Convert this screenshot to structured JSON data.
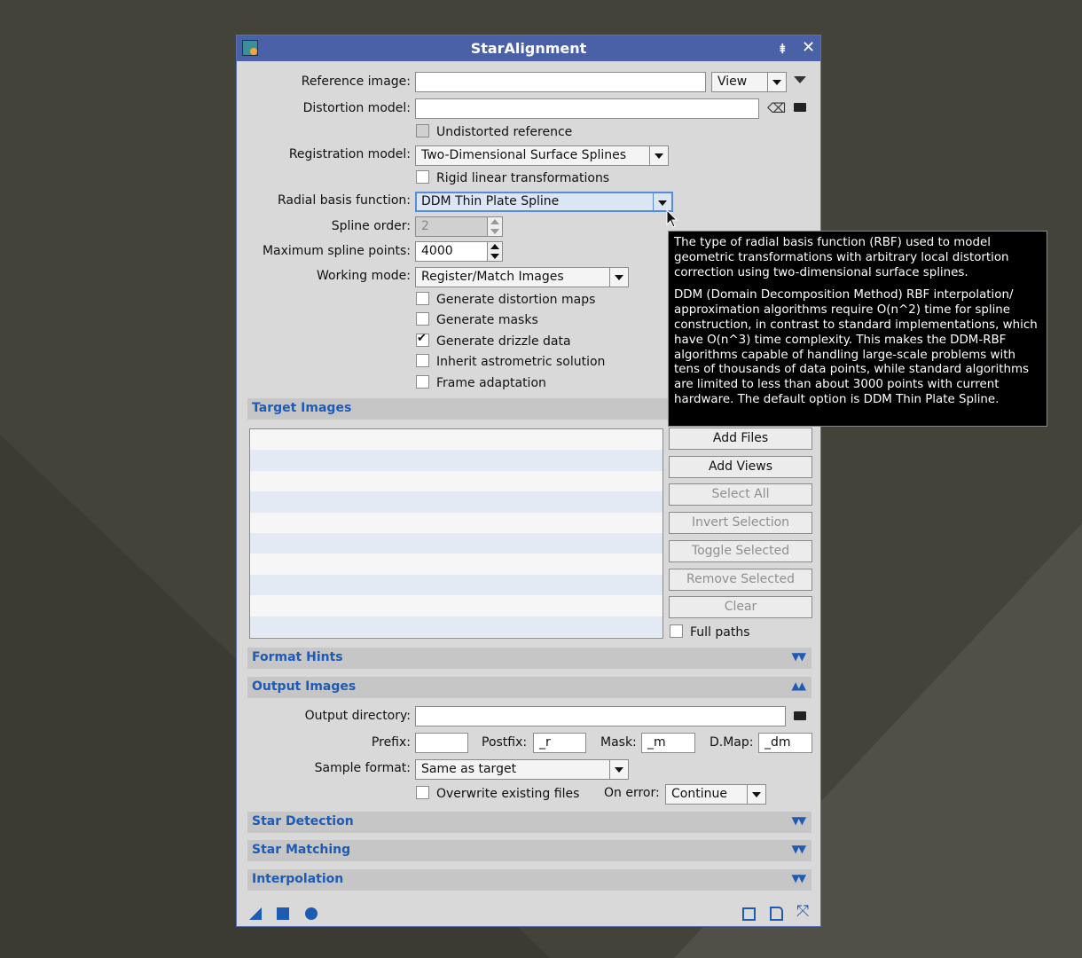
{
  "window": {
    "title": "StarAlignment",
    "shade_icon": "shade-icon",
    "close_icon": "close-icon"
  },
  "form": {
    "reference_image_label": "Reference image:",
    "reference_image_value": "",
    "reference_view_option": "View",
    "distortion_model_label": "Distortion model:",
    "distortion_model_value": "",
    "undistorted_reference": "Undistorted reference",
    "registration_model_label": "Registration model:",
    "registration_model_value": "Two-Dimensional Surface Splines",
    "rigid_linear": "Rigid linear transformations",
    "radial_basis_label": "Radial basis function:",
    "radial_basis_value": "DDM Thin Plate Spline",
    "spline_order_label": "Spline order:",
    "spline_order_value": "2",
    "max_spline_points_label": "Maximum spline points:",
    "max_spline_points_value": "4000",
    "working_mode_label": "Working mode:",
    "working_mode_value": "Register/Match Images",
    "checks": [
      {
        "label": "Generate distortion maps",
        "checked": false
      },
      {
        "label": "Generate masks",
        "checked": false
      },
      {
        "label": "Generate drizzle data",
        "checked": true
      },
      {
        "label": "Inherit astrometric solution",
        "checked": false
      },
      {
        "label": "Frame adaptation",
        "checked": false
      }
    ]
  },
  "target_images": {
    "section_title": "Target Images",
    "buttons": [
      "Add Files",
      "Add Views",
      "Select All",
      "Invert Selection",
      "Toggle Selected",
      "Remove Selected",
      "Clear"
    ],
    "full_paths": "Full paths"
  },
  "format_hints": {
    "section_title": "Format Hints"
  },
  "output_images": {
    "section_title": "Output Images",
    "output_directory_label": "Output directory:",
    "output_directory_value": "",
    "prefix_label": "Prefix:",
    "prefix_value": "",
    "postfix_label": "Postfix:",
    "postfix_value": "_r",
    "mask_label": "Mask:",
    "mask_value": "_m",
    "dmap_label": "D.Map:",
    "dmap_value": "_dm",
    "sample_format_label": "Sample format:",
    "sample_format_value": "Same as target",
    "overwrite": "Overwrite existing files",
    "on_error_label": "On error:",
    "on_error_value": "Continue"
  },
  "sections": {
    "star_detection": "Star Detection",
    "star_matching": "Star Matching",
    "interpolation": "Interpolation"
  },
  "tooltip": {
    "p1": "The type of radial basis function (RBF) used to model geometric transformations with arbitrary local distortion correction using two-dimensional surface splines.",
    "p2": "DDM (Domain Decomposition Method) RBF interpolation/ approximation algorithms require O(n^2) time for spline construction, in contrast to standard implementations, which have O(n^3) time complexity. This makes the DDM-RBF algorithms capable of handling large-scale problems with tens of thousands of data points, while standard algorithms are limited to less than about 3000 points with current hardware. The default option is DDM Thin Plate Spline."
  },
  "colors": {
    "accent": "#1d5bb5",
    "titlebar": "#4a61a8",
    "panel": "#d9d9d9"
  }
}
